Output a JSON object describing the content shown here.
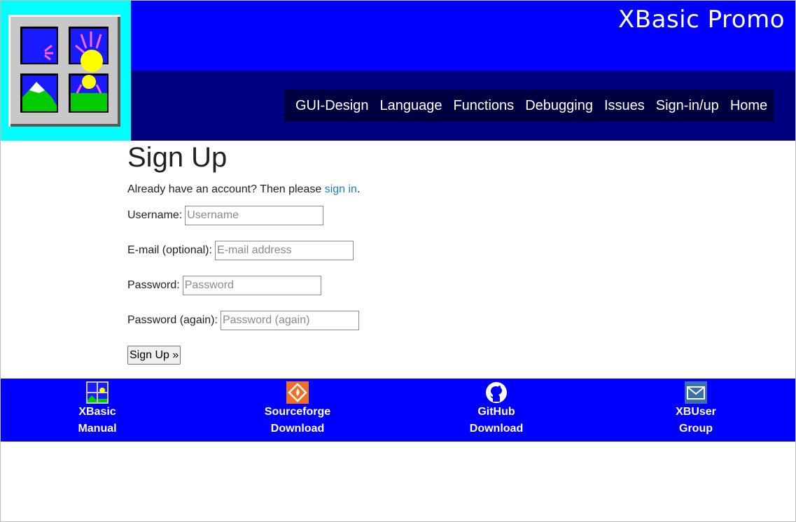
{
  "header": {
    "site_title": "XBasic Promo",
    "nav": [
      "GUI-Design",
      "Language",
      "Functions",
      "Debugging",
      "Issues",
      "Sign-in/up",
      "Home"
    ]
  },
  "main": {
    "title": "Sign Up",
    "intro_prefix": "Already have an account? Then please ",
    "intro_link": "sign in",
    "intro_suffix": ".",
    "fields": {
      "username": {
        "label": "Username:",
        "placeholder": "Username"
      },
      "email": {
        "label": "E-mail (optional):",
        "placeholder": "E-mail address"
      },
      "password": {
        "label": "Password:",
        "placeholder": "Password"
      },
      "password2": {
        "label": "Password (again):",
        "placeholder": "Password (again)"
      }
    },
    "submit_label": "Sign Up »"
  },
  "footer": {
    "links": [
      {
        "line1": "XBasic",
        "line2": "Manual",
        "icon": "xbasic-manual-icon"
      },
      {
        "line1": "Sourceforge",
        "line2": "Download",
        "icon": "sourceforge-icon"
      },
      {
        "line1": "GitHub",
        "line2": "Download",
        "icon": "github-icon"
      },
      {
        "line1": "XBUser",
        "line2": "Group",
        "icon": "mail-group-icon"
      }
    ]
  },
  "colors": {
    "header_blue": "#0000ff",
    "nav_navy": "#000080",
    "logo_cyan": "#00ffff",
    "link_blue": "#1a7ec2"
  }
}
